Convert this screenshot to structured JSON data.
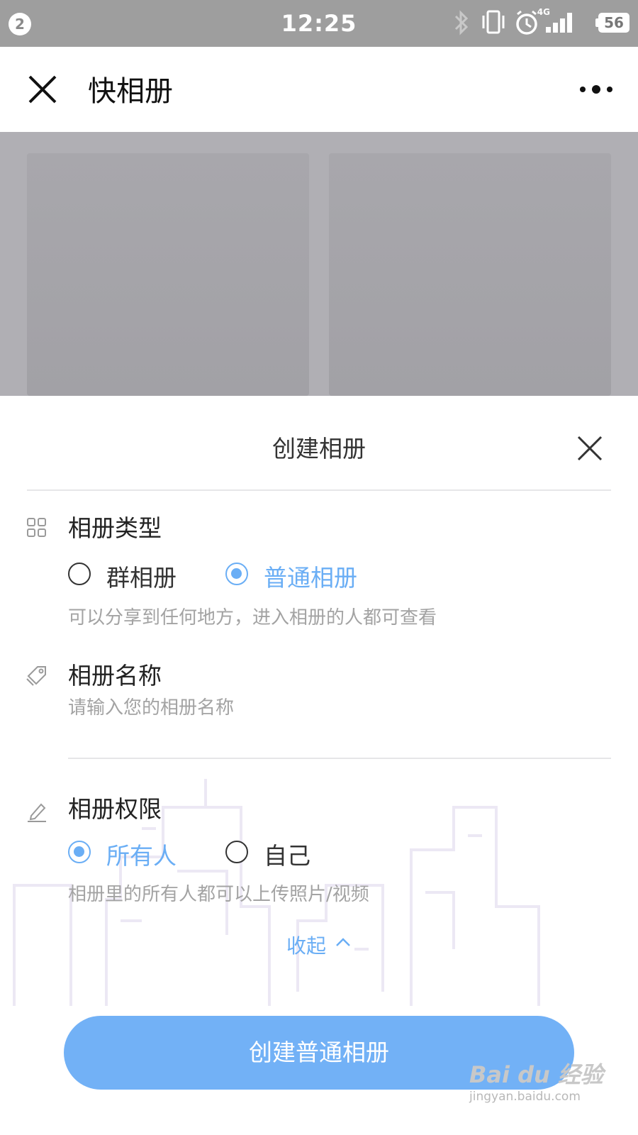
{
  "status_bar": {
    "notification_count": "2",
    "time": "12:25",
    "network_type": "4G",
    "battery": "56",
    "icons": [
      "bluetooth-icon",
      "vibrate-icon",
      "alarm-icon",
      "signal-icon",
      "battery-icon"
    ]
  },
  "header": {
    "title": "快相册",
    "close_icon": "close-icon",
    "more_icon": "more-icon"
  },
  "sheet": {
    "title": "创建相册",
    "album_type": {
      "label": "相册类型",
      "icon": "grid-icon",
      "options": [
        {
          "label": "群相册",
          "selected": false
        },
        {
          "label": "普通相册",
          "selected": true
        }
      ],
      "hint": "可以分享到任何地方，进入相册的人都可查看"
    },
    "album_name": {
      "label": "相册名称",
      "icon": "tag-icon",
      "placeholder": "请输入您的相册名称",
      "value": ""
    },
    "permission": {
      "label": "相册权限",
      "icon": "pencil-icon",
      "options": [
        {
          "label": "所有人",
          "selected": true
        },
        {
          "label": "自己",
          "selected": false
        }
      ],
      "hint": "相册里的所有人都可以上传照片/视频"
    },
    "collapse_label": "收起",
    "create_button": "创建普通相册"
  },
  "watermark": {
    "brand": "Bai du 经验",
    "url": "jingyan.baidu.com"
  },
  "colors": {
    "accent": "#6aaef5",
    "button": "#72b1f6",
    "status_bar": "#9e9e9e",
    "overlay": "#b0afb4"
  }
}
